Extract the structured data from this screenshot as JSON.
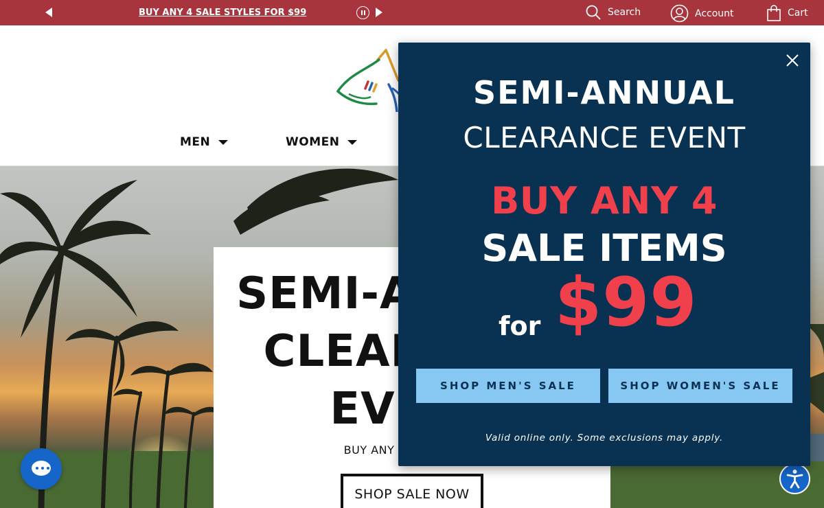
{
  "colors": {
    "topbar": "#a8343e",
    "modal_bg": "#093152",
    "accent_red": "#f0404c",
    "modal_button": "#86c8f2",
    "widget_blue": "#1566c8"
  },
  "topbar": {
    "prev_icon": "triangle-left-icon",
    "promo_text": "BUY ANY 4 SALE STYLES FOR $99",
    "pause_icon": "pause-icon",
    "next_icon": "triangle-right-icon",
    "search_label": "Search",
    "account_label": "Account",
    "cart_label": "Cart"
  },
  "header": {
    "logo_icon": "shark-logo",
    "nav": [
      {
        "label": "MEN"
      },
      {
        "label": "WOMEN"
      }
    ]
  },
  "hero": {
    "title_line1": "SEMI-ANNUAL",
    "title_line2": "CLEARANCE",
    "title_line3": "EVENT",
    "subtitle": "BUY ANY 4 MARKDOWN",
    "button_label": "SHOP SALE NOW"
  },
  "modal": {
    "heading": "SEMI-ANNUAL",
    "subheading": "CLEARANCE EVENT",
    "offer_line1": "BUY ANY 4",
    "offer_line2": "SALE ITEMS",
    "for_text": "for",
    "price": "$99",
    "button_men": "SHOP MEN'S SALE",
    "button_women": "SHOP WOMEN'S SALE",
    "disclaimer": "Valid online only. Some exclusions may apply.",
    "close_icon": "close-icon"
  },
  "widgets": {
    "chat_icon": "chat-bubble-icon",
    "accessibility_icon": "accessibility-icon"
  }
}
